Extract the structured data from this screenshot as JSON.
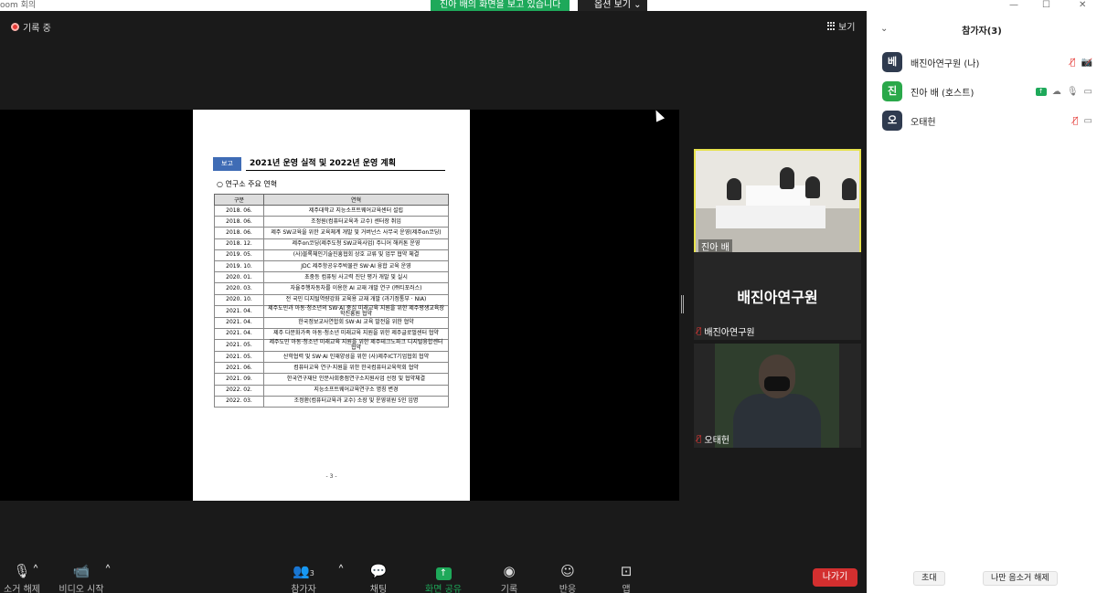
{
  "window": {
    "title": "oom 회의",
    "minimize": "—",
    "maximize": "☐",
    "close": "✕"
  },
  "banner": {
    "sharing_text": "진아 배의 화면을 보고 있습니다",
    "view_options": "옵션 보기"
  },
  "meeting": {
    "recording": "기록 중",
    "view_label": "보기"
  },
  "document": {
    "badge": "보고",
    "title": "2021년 운영 실적 및 2022년 운영 계획",
    "section": "○ 연구소 주요 연혁",
    "headers": [
      "구분",
      "연혁"
    ],
    "rows": [
      [
        "2018. 06.",
        "제주대학교 지능소프트웨어교육센터 설립"
      ],
      [
        "2018. 06.",
        "조정원(컴퓨터교육과 교수) 센터장 취임"
      ],
      [
        "2018. 06.",
        "제주 SW교육을 위한 교육체계 개발 및 거버넌스 사무국 운영(제주on코딩)"
      ],
      [
        "2018. 12.",
        "제주on코딩(제주도청 SW교육사업) 주니어 해커톤 운영"
      ],
      [
        "2019. 05.",
        "(사)블록체인기술진흥협회 상호 교류 및 업무 협약 체결"
      ],
      [
        "2019. 10.",
        "JDC 제주항공우주박물관 SW·AI 융합 교육 운영"
      ],
      [
        "2020. 01.",
        "초중등 컴퓨팅 사고력 진단 평가 개발 및 실시"
      ],
      [
        "2020. 03.",
        "자율주행자동차를 이용한 AI 교재 개발 연구 (㈜티포러스)"
      ],
      [
        "2020. 10.",
        "전 국민 디지털역량강화 교육용 교재 개발 (과기정통부 · NIA)"
      ],
      [
        "2021. 04.",
        "제주도민과 아동·청소년의 SW·AI 중심 미래교육 지원을 위한 제주평생교육장학진흥원 협약"
      ],
      [
        "2021. 04.",
        "한국정보교사연합회 SW·AI 교육 발전을 위한 협약"
      ],
      [
        "2021. 04.",
        "제주 다문화가족 아동·청소년 미래교육 지원을 위한 제주글로벌센터 협약"
      ],
      [
        "2021. 05.",
        "제주도민 아동·청소년 미래교육 지원을 위한 제주테크노파크 디지털융합센터 협약"
      ],
      [
        "2021. 05.",
        "산학협력 및 SW·AI 인재양성을 위한 (사)제주ICT기업협회 협약"
      ],
      [
        "2021. 06.",
        "컴퓨터교육 연구·지원을 위한 한국컴퓨터교육학회 협약"
      ],
      [
        "2021. 09.",
        "한국연구재단 인문사회중점연구소지원사업 선정 및 협약체결"
      ],
      [
        "2022. 02.",
        "지능소프트웨어교육연구소 명칭 변경"
      ],
      [
        "2022. 03.",
        "조정환(컴퓨터교육과 교수) 소장 및 운영위원 5인 임명"
      ]
    ],
    "page_number": "- 3 -"
  },
  "tiles": [
    {
      "name": "진아 배"
    },
    {
      "name": "배진아연구원",
      "display_name": "배진아연구원"
    },
    {
      "name": "오태헌"
    }
  ],
  "toolbar": {
    "mute": "소거 해제",
    "video": "비디오 시작",
    "participants": "참가자",
    "participants_count": "3",
    "chat": "채팅",
    "share": "화면 공유",
    "record": "기록",
    "reactions": "반응",
    "apps": "앱",
    "leave": "나가기"
  },
  "panel": {
    "title": "참가자(3)",
    "participants": [
      {
        "avatar": "베",
        "name": "배진아연구원 (나)",
        "color": "#2f3b4f"
      },
      {
        "avatar": "진",
        "name": "진아 배 (호스트)",
        "color": "#2aa84a"
      },
      {
        "avatar": "오",
        "name": "오태헌",
        "color": "#2f3b4f"
      }
    ],
    "invite": "초대",
    "unmute_me": "나만 음소거 해제"
  }
}
